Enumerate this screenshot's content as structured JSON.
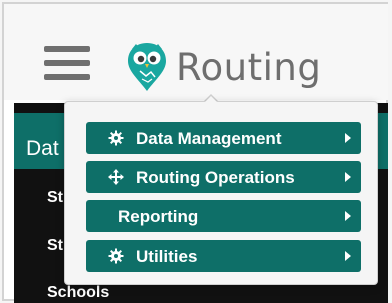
{
  "header": {
    "brand_name": "Routing",
    "brand_color": "#6e6e6e",
    "logo_color": "#1aa7a0",
    "menu_icon": "hamburger-icon"
  },
  "sidebar": {
    "title": "Dat",
    "items": [
      {
        "label": "St"
      },
      {
        "label": "St"
      },
      {
        "label": "Schools"
      }
    ],
    "accent": "#0e6f68"
  },
  "dropdown": {
    "items": [
      {
        "label": "Data Management",
        "icon": "gear-icon"
      },
      {
        "label": "Routing Operations",
        "icon": "move-arrows-icon"
      },
      {
        "label": "Reporting",
        "icon": ""
      },
      {
        "label": "Utilities",
        "icon": "gear-icon"
      }
    ],
    "button_color": "#0e6f68"
  }
}
